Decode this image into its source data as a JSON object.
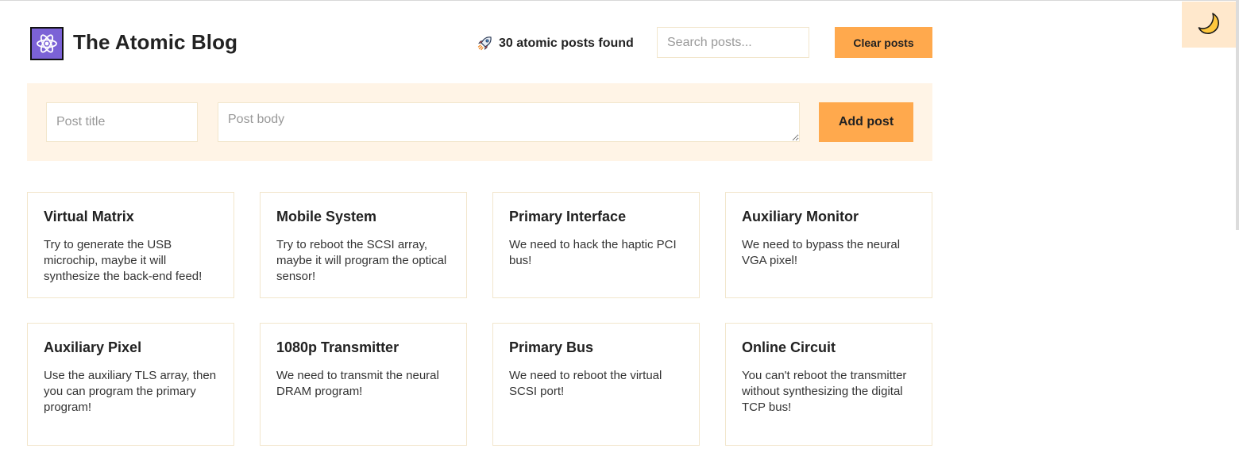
{
  "header": {
    "title": "The Atomic Blog",
    "logo_icon": "atom-icon",
    "count_icon": "rocket-icon",
    "count_text": "30 atomic posts found",
    "search_placeholder": "Search posts...",
    "clear_label": "Clear posts"
  },
  "form": {
    "title_placeholder": "Post title",
    "body_placeholder": "Post body",
    "add_label": "Add post"
  },
  "theme_toggle": {
    "icon": "moon-icon"
  },
  "posts": [
    {
      "title": "Virtual Matrix",
      "body": "Try to generate the USB microchip, maybe it will synthesize the back-end feed!"
    },
    {
      "title": "Mobile System",
      "body": "Try to reboot the SCSI array, maybe it will program the optical sensor!"
    },
    {
      "title": "Primary Interface",
      "body": "We need to hack the haptic PCI bus!"
    },
    {
      "title": "Auxiliary Monitor",
      "body": "We need to bypass the neural VGA pixel!"
    },
    {
      "title": "Auxiliary Pixel",
      "body": "Use the auxiliary TLS array, then you can program the primary program!"
    },
    {
      "title": "1080p Transmitter",
      "body": "We need to transmit the neural DRAM program!"
    },
    {
      "title": "Primary Bus",
      "body": "We need to reboot the virtual SCSI port!"
    },
    {
      "title": "Online Circuit",
      "body": "You can't reboot the transmitter without synthesizing the digital TCP bus!"
    }
  ],
  "colors": {
    "accent": "#ffa94d",
    "form_background": "#fff4e6",
    "toggle_background": "#ffe8cc",
    "logo_background": "#7b62d6"
  }
}
